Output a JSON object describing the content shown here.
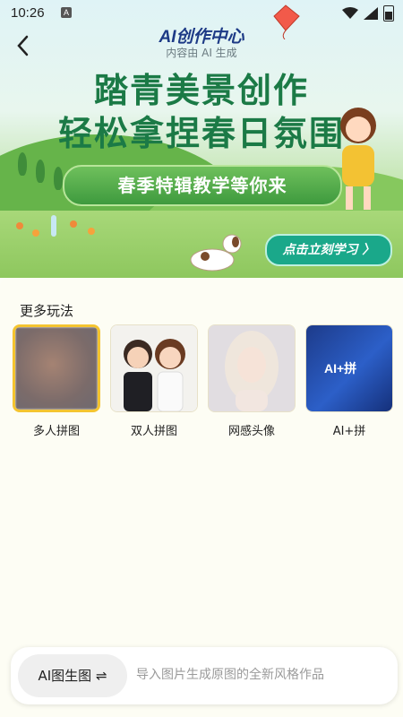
{
  "status_bar": {
    "time": "10:26",
    "badge": "A"
  },
  "header": {
    "title": "AI创作中心",
    "subtitle": "内容由 AI 生成"
  },
  "banner": {
    "headline_line1": "踏青美景创作",
    "headline_line2": "轻松拿捏春日氛围",
    "pill_text": "春季特辑教学等你来",
    "cta_label": "点击立刻学习 〉"
  },
  "more": {
    "title": "更多玩法",
    "items": [
      {
        "label": "多人拼图",
        "selected": true
      },
      {
        "label": "双人拼图",
        "selected": false
      },
      {
        "label": "网感头像",
        "selected": false
      },
      {
        "label": "AI+拼",
        "selected": false
      }
    ],
    "puzzle_thumb_text": "AI+拼"
  },
  "input": {
    "mode_label": "AI图生图 ⇌",
    "placeholder": "导入图片生成原图的全新风格作品"
  },
  "colors": {
    "accent_green": "#1b7a46",
    "cta_teal": "#1aa88a",
    "selected_border": "#f4c430"
  }
}
